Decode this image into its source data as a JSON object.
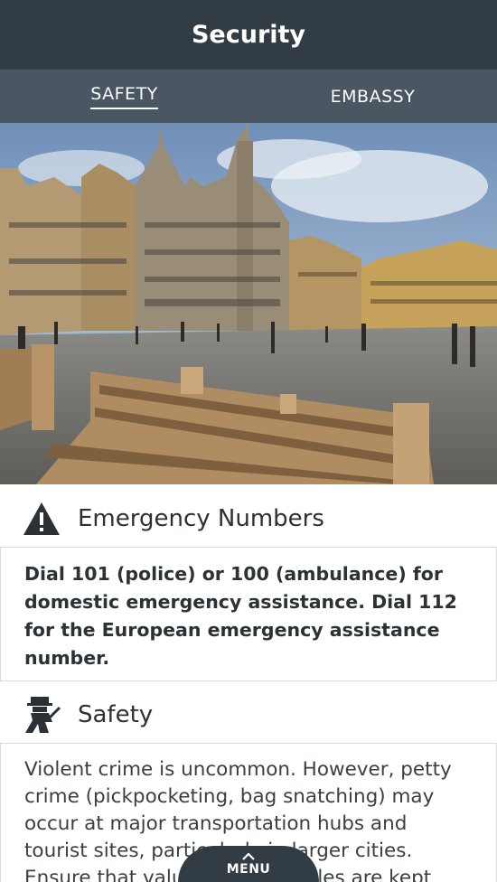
{
  "header": {
    "title": "Security"
  },
  "tabs": [
    {
      "label": "SAFETY",
      "active": true
    },
    {
      "label": "EMBASSY",
      "active": false
    }
  ],
  "emergency": {
    "icon": "warning-icon",
    "title": "Emergency Numbers",
    "text": "Dial 101 (police) or 100 (ambulance) for domestic emergency assistance. Dial 112 for the European emergency assistance number."
  },
  "safety": {
    "icon": "thief-icon",
    "title": "Safety",
    "text": "Violent crime is uncommon. However, petty crime (pickpocketing, bag snatching) may occur at major transportation hubs and tourist sites, particularly in larger cities. Ensure that valuables in vehicles are kept"
  },
  "menu": {
    "label": "MENU",
    "icon": "chevron-up-icon"
  },
  "colors": {
    "header_bg": "#323c45",
    "tabs_bg": "#4a5661"
  }
}
